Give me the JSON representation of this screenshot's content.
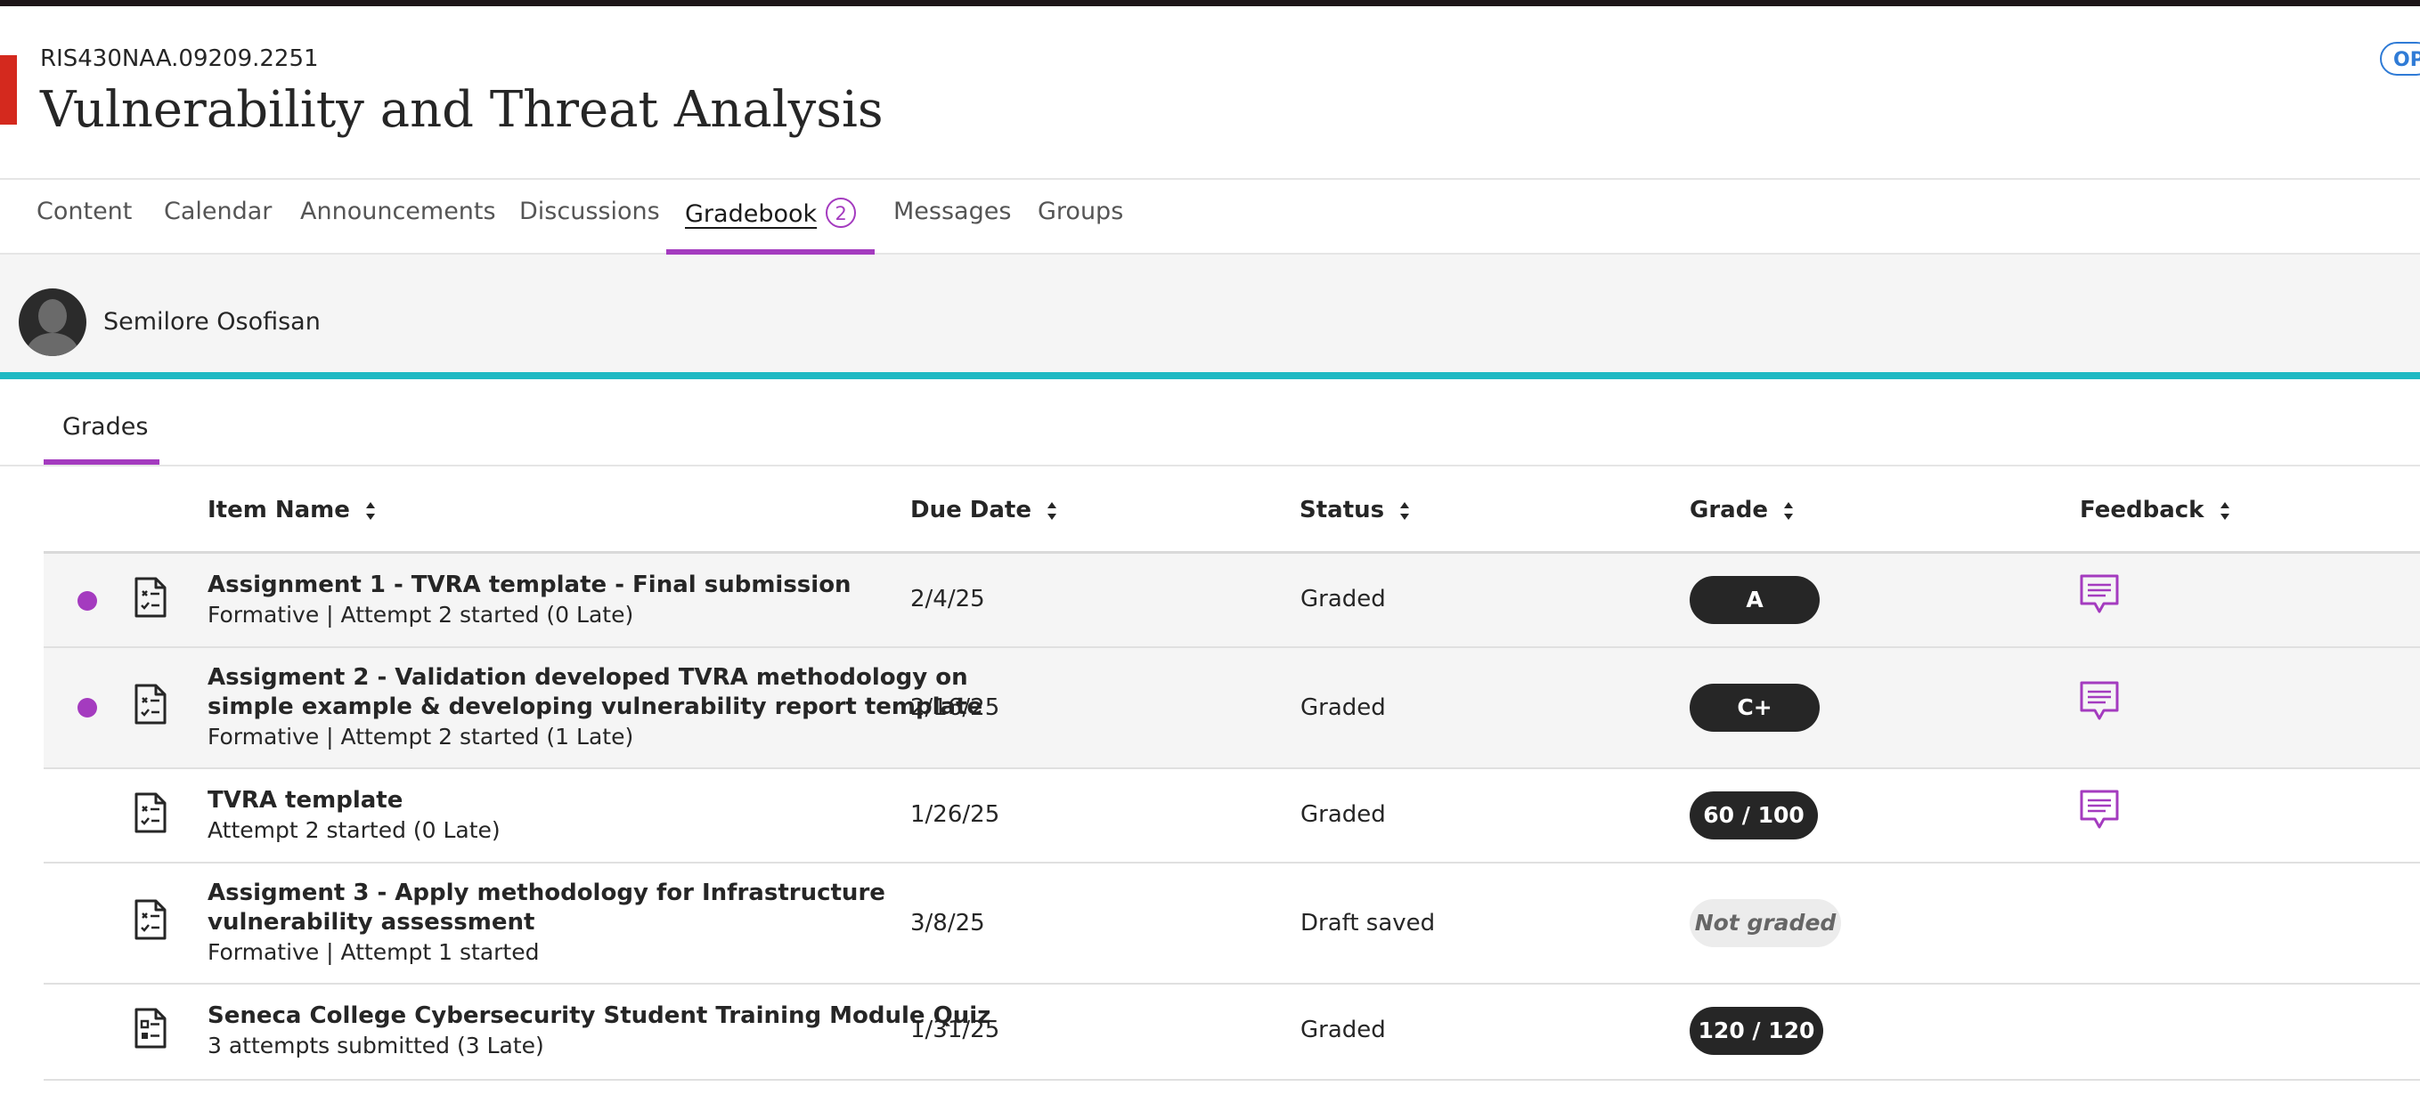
{
  "course": {
    "id": "RIS430NAA.09209.2251",
    "title": "Vulnerability and Threat Analysis",
    "badge": "OP"
  },
  "nav": {
    "tabs": [
      {
        "label": "Content"
      },
      {
        "label": "Calendar"
      },
      {
        "label": "Announcements"
      },
      {
        "label": "Discussions"
      },
      {
        "label": "Gradebook",
        "badge": "2",
        "active": true
      },
      {
        "label": "Messages"
      },
      {
        "label": "Groups"
      }
    ]
  },
  "student": {
    "name": "Semilore Osofisan"
  },
  "subtabs": {
    "grades": "Grades"
  },
  "table": {
    "columns": {
      "item_name": "Item Name",
      "due_date": "Due Date",
      "status": "Status",
      "grade": "Grade",
      "feedback": "Feedback"
    },
    "rows": [
      {
        "title": "Assignment 1 - TVRA template - Final submission",
        "subtitle": "Formative | Attempt 2 started (0 Late)",
        "due": "2/4/25",
        "status": "Graded",
        "grade": "A",
        "new": true,
        "feedback": true,
        "icon": "assignment-doc-icon"
      },
      {
        "title_line1": "Assigment 2 - Validation developed TVRA methodology on",
        "title_line2": "simple example & developing vulnerability report template",
        "subtitle": "Formative | Attempt 2 started (1 Late)",
        "due": "2/16/25",
        "status": "Graded",
        "grade": "C+",
        "new": true,
        "feedback": true,
        "icon": "assignment-doc-icon"
      },
      {
        "title": "TVRA template",
        "subtitle": "Attempt 2 started (0 Late)",
        "due": "1/26/25",
        "status": "Graded",
        "grade": "60 / 100",
        "new": false,
        "feedback": true,
        "icon": "assignment-doc-icon"
      },
      {
        "title_line1": "Assigment 3 - Apply methodology for Infrastructure",
        "title_line2": "vulnerability assessment",
        "subtitle": "Formative | Attempt 1 started",
        "due": "3/8/25",
        "status": "Draft saved",
        "grade": "Not graded",
        "new": false,
        "feedback": false,
        "icon": "assignment-doc-icon"
      },
      {
        "title": "Seneca College Cybersecurity Student Training Module Quiz",
        "subtitle": "3 attempts submitted (3 Late)",
        "due": "1/31/25",
        "status": "Graded",
        "grade": "120 / 120",
        "new": false,
        "feedback": false,
        "icon": "test-doc-icon"
      }
    ]
  },
  "colors": {
    "accent_purple": "#a43bbf",
    "teal_bar": "#1fb9c3",
    "red_tab": "#d4291e",
    "open_badge_blue": "#2f7bd6"
  }
}
